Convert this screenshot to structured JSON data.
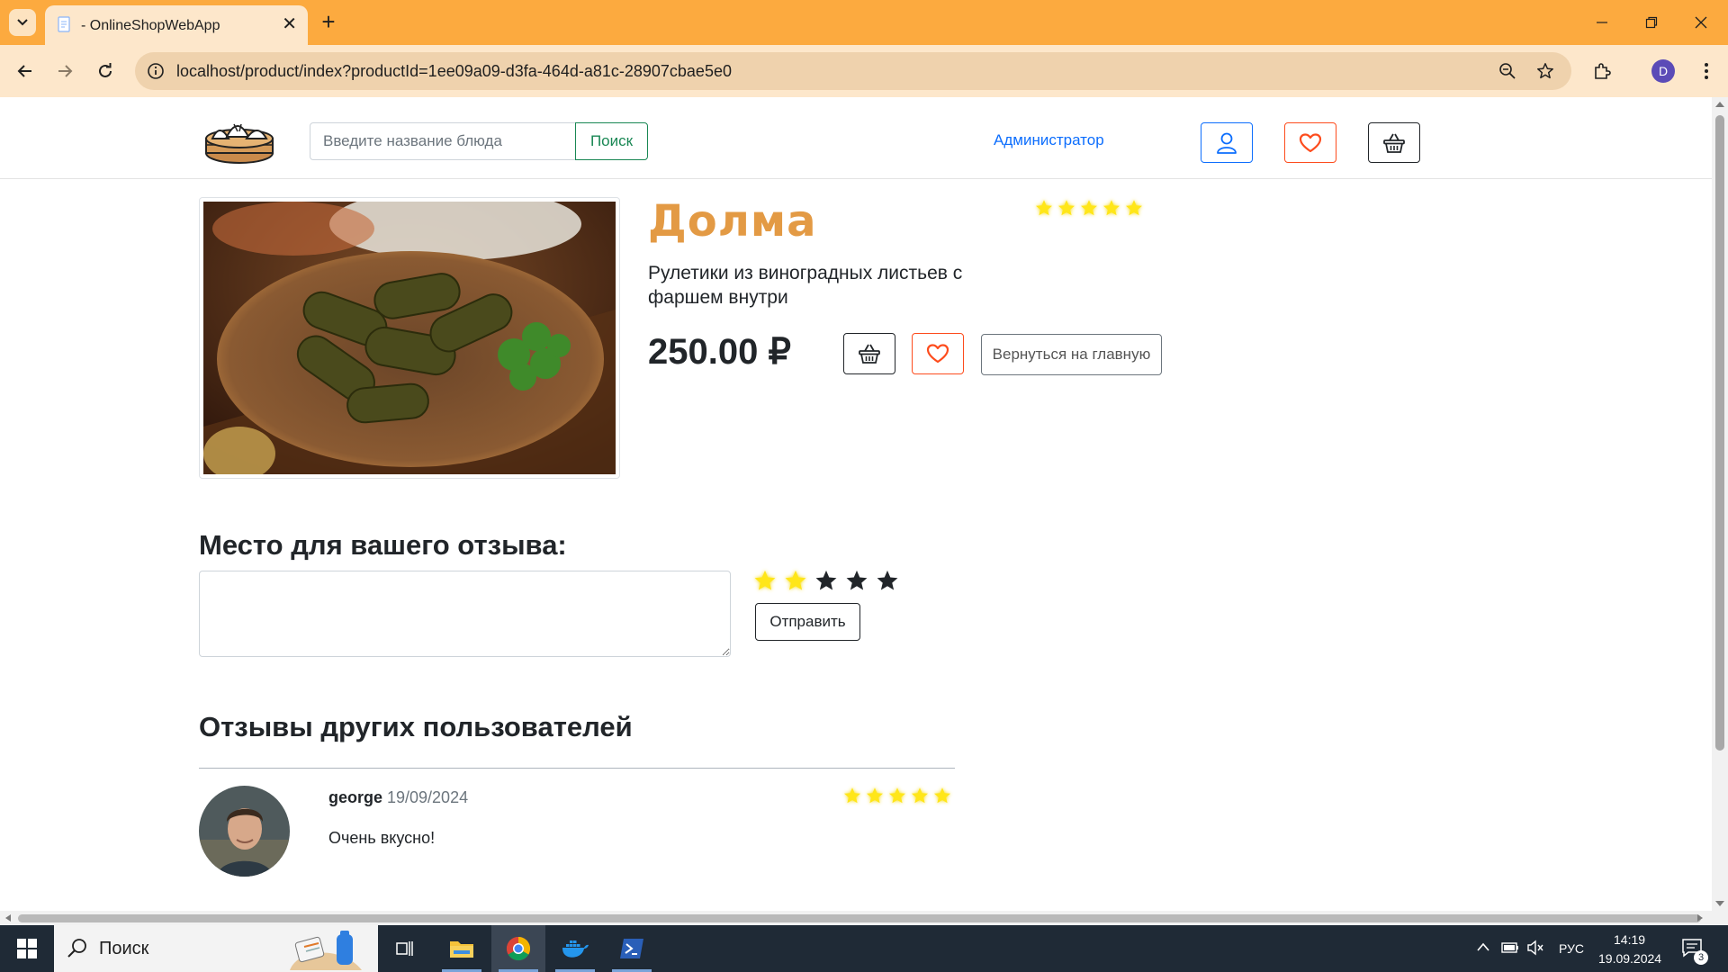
{
  "browser": {
    "tab_title": "- OnlineShopWebApp",
    "url": "localhost/product/index?productId=1ee09a09-d3fa-464d-a81c-28907cbae5e0",
    "profile_initial": "D"
  },
  "header": {
    "search_placeholder": "Введите название блюда",
    "search_button": "Поиск",
    "admin_link": "Администратор"
  },
  "product": {
    "title": "Долма",
    "description": "Рулетики из виноградных листьев с фаршем внутри",
    "price": "250.00 ₽",
    "rating": 5,
    "back_button": "Вернуться на главную"
  },
  "review_form": {
    "heading": "Место для вашего отзыва:",
    "selected_rating": 2,
    "submit_button": "Отправить"
  },
  "reviews": {
    "heading": "Отзывы других пользователей",
    "items": [
      {
        "user": "george",
        "date": "19/09/2024",
        "text": "Очень вкусно!",
        "rating": 5
      }
    ]
  },
  "taskbar": {
    "search_text": "Поиск",
    "lang": "РУС",
    "time": "14:19",
    "date": "19.09.2024",
    "notifications": "3"
  },
  "colors": {
    "browser_accent": "#fcaa3f",
    "title_color": "#e39a44",
    "star_filled": "#ffe619",
    "fav_color": "#fd4c1d",
    "link_color": "#0d6efd",
    "search_green": "#198754"
  }
}
